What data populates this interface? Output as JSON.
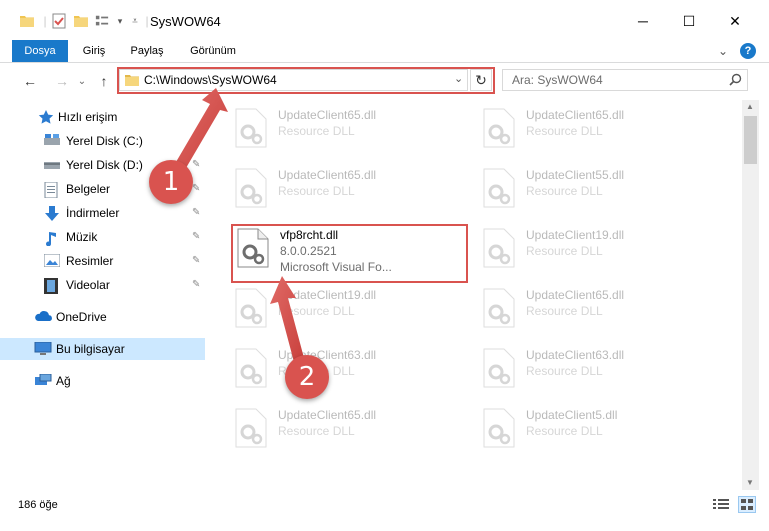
{
  "window": {
    "title": "SysWOW64",
    "minimize": "─",
    "maximize": "☐",
    "close": "✕"
  },
  "ribbon": {
    "tabs": [
      {
        "label": "Dosya",
        "active": true
      },
      {
        "label": "Giriş",
        "active": false
      },
      {
        "label": "Paylaş",
        "active": false
      },
      {
        "label": "Görünüm",
        "active": false
      }
    ],
    "expand": "⌄",
    "help": "?"
  },
  "nav": {
    "back": "←",
    "forward": "→",
    "recent": "⌄",
    "up": "↑",
    "address": "C:\\Windows\\SysWOW64",
    "address_dropdown": "⌄",
    "refresh": "↻",
    "search_placeholder": "Ara: SysWOW64"
  },
  "sidebar": {
    "items": [
      {
        "label": "Hızlı erişim",
        "icon": "star-icon"
      },
      {
        "label": "Yerel Disk (C:)",
        "icon": "drive-icon",
        "pinned": true
      },
      {
        "label": "Yerel Disk (D:)",
        "icon": "drive-icon",
        "pinned": true
      },
      {
        "label": "Belgeler",
        "icon": "documents-icon",
        "pinned": true
      },
      {
        "label": "İndirmeler",
        "icon": "download-icon",
        "pinned": true
      },
      {
        "label": "Müzik",
        "icon": "music-icon",
        "pinned": true
      },
      {
        "label": "Resimler",
        "icon": "pictures-icon",
        "pinned": true
      },
      {
        "label": "Videolar",
        "icon": "videos-icon",
        "pinned": true
      },
      {
        "label": "OneDrive",
        "icon": "onedrive-icon"
      },
      {
        "label": "Bu bilgisayar",
        "icon": "computer-icon",
        "selected": true
      },
      {
        "label": "Ağ",
        "icon": "network-icon"
      }
    ],
    "pin_glyph": "📌"
  },
  "files": {
    "left": [
      {
        "name": "UpdateClient65.dll",
        "type": "Resource DLL",
        "faded": true
      },
      {
        "name": "UpdateClient65.dll",
        "type": "Resource DLL",
        "faded": true
      },
      {
        "name": "vfp8rcht.dll",
        "type": "8.0.0.2521",
        "extra": "Microsoft Visual Fo...",
        "faded": false
      },
      {
        "name": "UpdateClient19.dll",
        "type": "Resource DLL",
        "faded": true
      },
      {
        "name": "UpdateClient63.dll",
        "type": "Resource DLL",
        "faded": true
      },
      {
        "name": "UpdateClient65.dll",
        "type": "Resource DLL",
        "faded": true
      }
    ],
    "right": [
      {
        "name": "UpdateClient65.dll",
        "type": "Resource DLL",
        "faded": true
      },
      {
        "name": "UpdateClient55.dll",
        "type": "Resource DLL",
        "faded": true
      },
      {
        "name": "UpdateClient19.dll",
        "type": "Resource DLL",
        "faded": true
      },
      {
        "name": "UpdateClient65.dll",
        "type": "Resource DLL",
        "faded": true
      },
      {
        "name": "UpdateClient63.dll",
        "type": "Resource DLL",
        "faded": true
      },
      {
        "name": "UpdateClient5.dll",
        "type": "Resource DLL",
        "faded": true
      }
    ]
  },
  "status": {
    "count": "186 öğe"
  },
  "callouts": [
    "1",
    "2"
  ],
  "colors": {
    "accent": "#1979ca",
    "highlight": "#d9534f",
    "selected": "#cce8ff"
  }
}
